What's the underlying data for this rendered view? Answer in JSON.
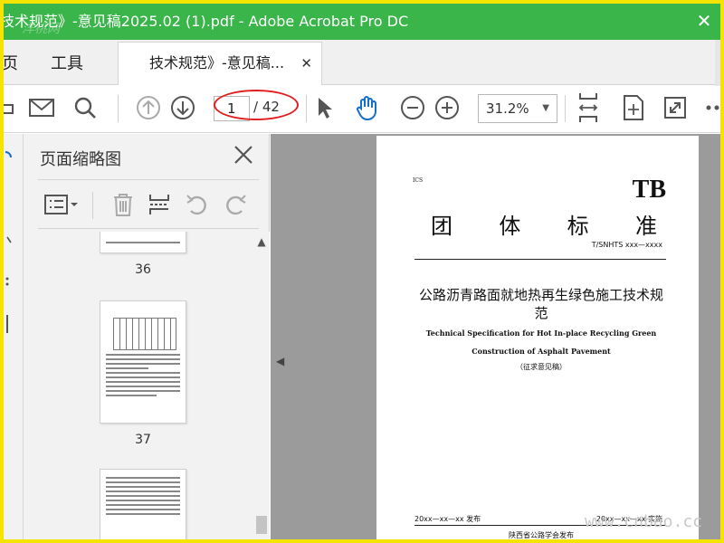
{
  "window": {
    "title": "技术规范》-意见稿2025.02 (1).pdf - Adobe Acrobat Pro DC",
    "close_glyph": "✕",
    "watermark_left": "洋桃网"
  },
  "tabs": {
    "home": "页",
    "tools": "工具",
    "document": "技术规范》-意见稿...",
    "document_close": "✕"
  },
  "toolbar": {
    "current_page": "1",
    "total_pages": "/ 42",
    "zoom": "31.2%",
    "icons": [
      "print-icon",
      "email-icon",
      "search-icon",
      "prev-page-icon",
      "next-page-icon",
      "select-arrow-icon",
      "hand-tool-icon",
      "zoom-out-icon",
      "zoom-in-icon",
      "fit-width-icon",
      "fit-page-icon",
      "fullscreen-icon",
      "more-icon"
    ]
  },
  "thumbnails_panel": {
    "title": "页面缩略图",
    "pages": [
      {
        "label": "36"
      },
      {
        "label": "37"
      },
      {
        "label": ""
      }
    ]
  },
  "document": {
    "ics": "ICS",
    "tb_mark": "TB",
    "standard_type": [
      "团",
      "体",
      "标",
      "准"
    ],
    "standard_code": "T/SNHTS xxx—xxxx",
    "title_zh": "公路沥青路面就地热再生绿色施工技术规范",
    "title_en": "Technical Specification for Hot In-place Recycling Green Construction of Asphalt Pavement",
    "draft_note": "（征求意见稿）",
    "issue_date": "20xx—xx—xx 发布",
    "impl_date": "20xx—xx—xx 实施",
    "publisher": "陕西省公路学会发布"
  },
  "site_watermark": "www.cnbao.cc",
  "colors": {
    "title_bar": "#39b54a",
    "border_highlight": "#f5e400",
    "annotation_oval": "#e02020",
    "doc_background": "#9b9b9b"
  }
}
